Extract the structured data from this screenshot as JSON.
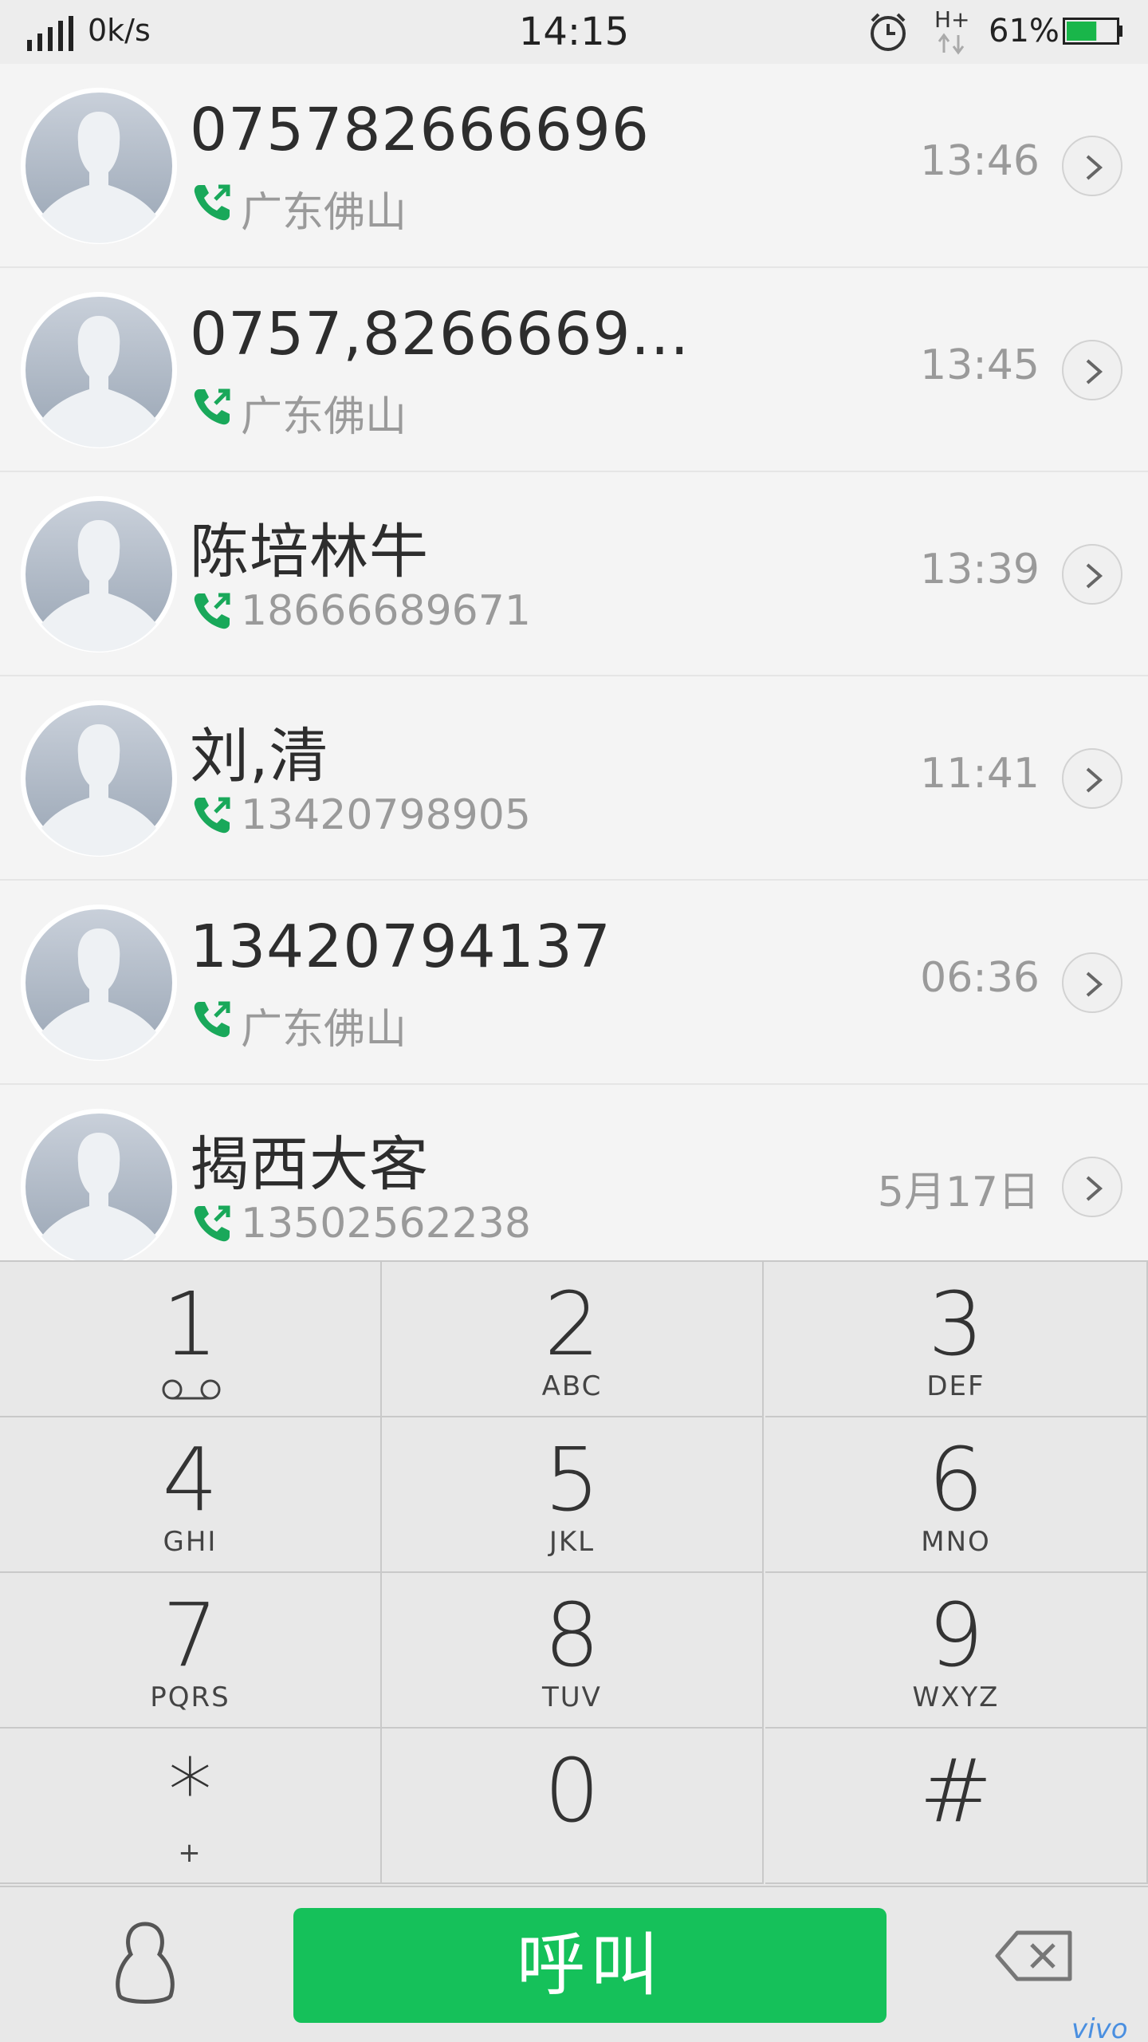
{
  "status_bar": {
    "net_speed": "0k/s",
    "time": "14:15",
    "network_type": "H+",
    "battery_percent": "61%",
    "battery_level": 0.61,
    "battery_color": "#19b64a"
  },
  "call_log": [
    {
      "name": "075782666696",
      "sub": "广东佛山",
      "time": "13:46"
    },
    {
      "name": "0757,8266669...",
      "sub": "广东佛山",
      "time": "13:45"
    },
    {
      "name": "陈培林牛",
      "sub": "18666689671",
      "time": "13:39"
    },
    {
      "name": "刘,清",
      "sub": "13420798905",
      "time": "11:41"
    },
    {
      "name": "13420794137",
      "sub": "广东佛山",
      "time": "06:36"
    },
    {
      "name": "揭西大客",
      "sub": "13502562238",
      "time": "5月17日"
    }
  ],
  "dialpad": {
    "keys": [
      {
        "digit": "1",
        "letters": ""
      },
      {
        "digit": "2",
        "letters": "ABC"
      },
      {
        "digit": "3",
        "letters": "DEF"
      },
      {
        "digit": "4",
        "letters": "GHI"
      },
      {
        "digit": "5",
        "letters": "JKL"
      },
      {
        "digit": "6",
        "letters": "MNO"
      },
      {
        "digit": "7",
        "letters": "PQRS"
      },
      {
        "digit": "8",
        "letters": "TUV"
      },
      {
        "digit": "9",
        "letters": "WXYZ"
      },
      {
        "digit": "*",
        "letters": "+"
      },
      {
        "digit": "0",
        "letters": ""
      },
      {
        "digit": "#",
        "letters": ""
      }
    ]
  },
  "bottom_bar": {
    "call_label": "呼叫",
    "call_color": "#15c15a",
    "icons": [
      "contacts-icon",
      "backspace-icon"
    ]
  },
  "brand": "vivo",
  "colors": {
    "accent_green": "#15c15a",
    "phone_icon_green": "#19a85a"
  }
}
